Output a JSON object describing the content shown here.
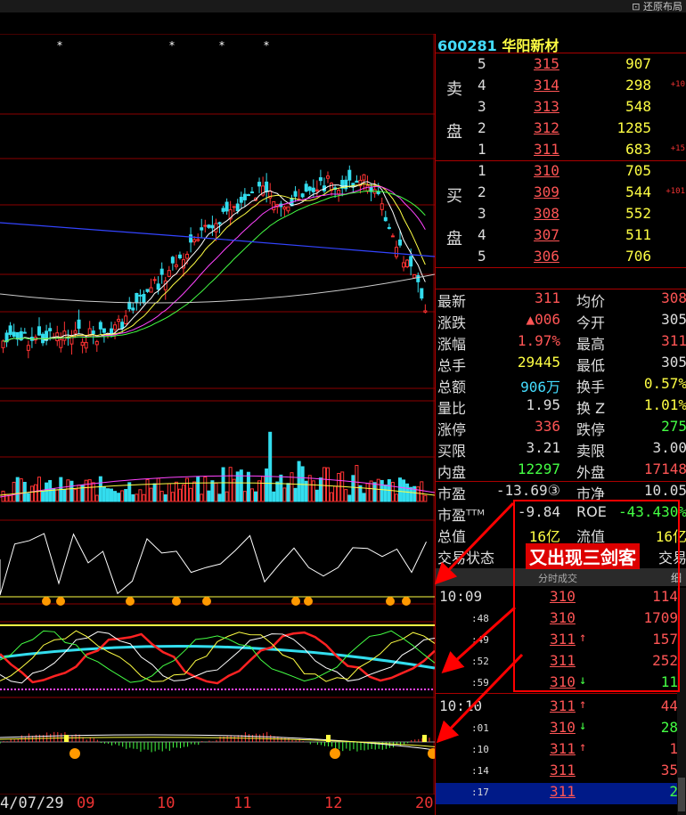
{
  "topbar": {
    "restore_label": "还原布局"
  },
  "xaxis": {
    "labels": [
      "4/07/29",
      "09",
      "10",
      "11",
      "12",
      "20"
    ]
  },
  "stock": {
    "code": "600281",
    "name": "华阳新材"
  },
  "orderbook": {
    "sell_label_1": "卖",
    "sell_label_2": "盘",
    "buy_label_1": "买",
    "buy_label_2": "盘",
    "sell": [
      {
        "level": "5",
        "price": "315",
        "vol": "907",
        "tag": ""
      },
      {
        "level": "4",
        "price": "314",
        "vol": "298",
        "tag": "+10"
      },
      {
        "level": "3",
        "price": "313",
        "vol": "548",
        "tag": ""
      },
      {
        "level": "2",
        "price": "312",
        "vol": "1285",
        "tag": ""
      },
      {
        "level": "1",
        "price": "311",
        "vol": "683",
        "tag": "+15"
      }
    ],
    "buy": [
      {
        "level": "1",
        "price": "310",
        "vol": "705",
        "tag": ""
      },
      {
        "level": "2",
        "price": "309",
        "vol": "544",
        "tag": "+101"
      },
      {
        "level": "3",
        "price": "308",
        "vol": "552",
        "tag": ""
      },
      {
        "level": "4",
        "price": "307",
        "vol": "511",
        "tag": ""
      },
      {
        "level": "5",
        "price": "306",
        "vol": "706",
        "tag": ""
      }
    ]
  },
  "quote": [
    {
      "l1": "最新",
      "v1": "311",
      "c1": "#ff5555",
      "l2": "均价",
      "v2": "308",
      "c2": "#ff5555"
    },
    {
      "l1": "涨跌",
      "v1": "▲006",
      "c1": "#ff5555",
      "l2": "今开",
      "v2": "305",
      "c2": "#ddd"
    },
    {
      "l1": "涨幅",
      "v1": "1.97%",
      "c1": "#ff5555",
      "l2": "最高",
      "v2": "311",
      "c2": "#ff5555"
    },
    {
      "l1": "总手",
      "v1": "29445",
      "c1": "#ffff44",
      "l2": "最低",
      "v2": "305",
      "c2": "#ddd"
    },
    {
      "l1": "总额",
      "v1": "906万",
      "c1": "#44ddff",
      "l2": "换手",
      "v2": "0.57%",
      "c2": "#ffff44"
    },
    {
      "l1": "量比",
      "v1": "1.95",
      "c1": "#ddd",
      "l2": "换 Z",
      "v2": "1.01%",
      "c2": "#ffff44"
    },
    {
      "l1": "涨停",
      "v1": "336",
      "c1": "#ff5555",
      "l2": "跌停",
      "v2": "275",
      "c2": "#44ff44"
    },
    {
      "l1": "买限",
      "v1": "3.21",
      "c1": "#ddd",
      "l2": "卖限",
      "v2": "3.00",
      "c2": "#ddd"
    },
    {
      "l1": "内盘",
      "v1": "12297",
      "c1": "#44ff44",
      "l2": "外盘",
      "v2": "17148",
      "c2": "#ff5555"
    },
    {
      "l1": "市盈",
      "v1": "-13.69③",
      "c1": "#ddd",
      "l2": "市净",
      "v2": "10.05",
      "c2": "#ddd"
    },
    {
      "l1": "市盈ᵀᵀᴹ",
      "v1": "-9.84",
      "c1": "#ddd",
      "l2": "ROE",
      "v2": "-43.430%",
      "c2": "#44ff44"
    },
    {
      "l1": "总值",
      "v1": "16亿",
      "c1": "#ffff44",
      "l2": "流值",
      "v2": "16亿",
      "c2": "#ffff44"
    },
    {
      "l1": "交易状态",
      "v1": "",
      "c1": "#ddd",
      "l2": "",
      "v2": "交易",
      "c2": "#ddd"
    }
  ],
  "ticks": {
    "header": "分时成交",
    "header_right": "细",
    "rows": [
      {
        "time": "10:09",
        "small": false,
        "price": "310",
        "arrow": "",
        "acolor": "#fff",
        "vol": "114",
        "vcolor": "#ff5555"
      },
      {
        "time": ":48",
        "small": true,
        "price": "310",
        "arrow": "",
        "acolor": "#fff",
        "vol": "1709",
        "vcolor": "#ff5555"
      },
      {
        "time": ":49",
        "small": true,
        "price": "311",
        "arrow": "↑",
        "acolor": "#ff5555",
        "vol": "157",
        "vcolor": "#ff5555"
      },
      {
        "time": ":52",
        "small": true,
        "price": "311",
        "arrow": "",
        "acolor": "#fff",
        "vol": "252",
        "vcolor": "#ff5555"
      },
      {
        "time": ":59",
        "small": true,
        "price": "310",
        "arrow": "↓",
        "acolor": "#44ff44",
        "vol": "11",
        "vcolor": "#44ff44"
      },
      {
        "time": "10:10",
        "small": false,
        "price": "311",
        "arrow": "↑",
        "acolor": "#ff5555",
        "vol": "44",
        "vcolor": "#ff5555"
      },
      {
        "time": ":01",
        "small": true,
        "price": "310",
        "arrow": "↓",
        "acolor": "#44ff44",
        "vol": "28",
        "vcolor": "#44ff44"
      },
      {
        "time": ":10",
        "small": true,
        "price": "311",
        "arrow": "↑",
        "acolor": "#ff5555",
        "vol": "1",
        "vcolor": "#ff5555"
      },
      {
        "time": ":14",
        "small": true,
        "price": "311",
        "arrow": "",
        "acolor": "#fff",
        "vol": "35",
        "vcolor": "#ff5555"
      },
      {
        "time": ":17",
        "small": true,
        "price": "311",
        "arrow": "",
        "acolor": "#fff",
        "vol": "2",
        "vcolor": "#44ff44"
      }
    ]
  },
  "annotation": {
    "text": "又出现三剑客"
  },
  "colors": {
    "up": "#ff3333",
    "down": "#33ddee",
    "accent_yellow": "#ffff44",
    "grid": "#8b0000"
  }
}
